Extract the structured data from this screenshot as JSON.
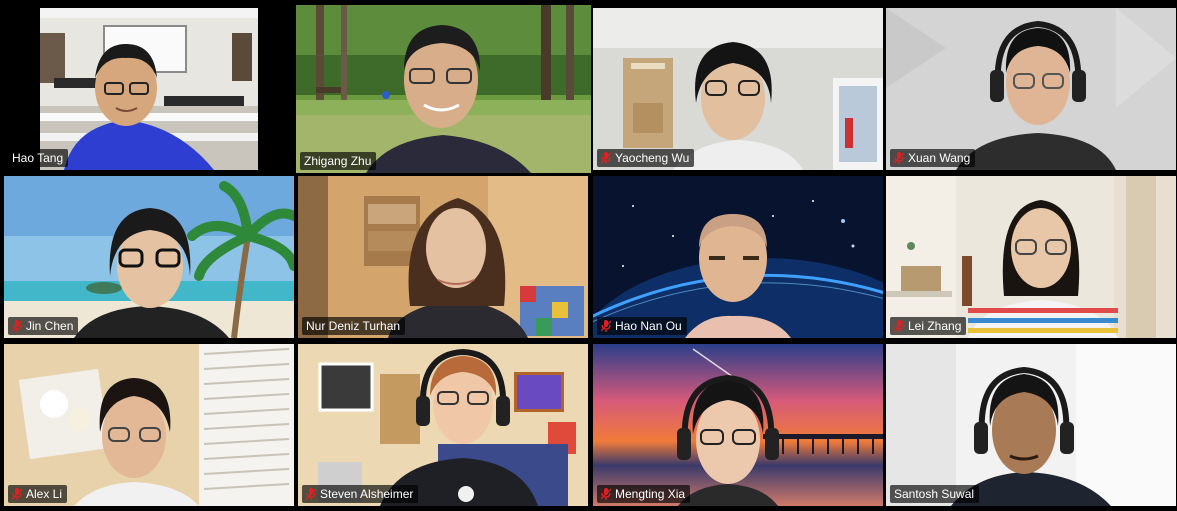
{
  "participants": [
    {
      "name": "Hao Tang",
      "muted": false,
      "active": false,
      "bg": "classroom"
    },
    {
      "name": "Zhigang Zhu",
      "muted": false,
      "active": true,
      "bg": "park"
    },
    {
      "name": "Yaocheng Wu",
      "muted": true,
      "active": false,
      "bg": "room-white"
    },
    {
      "name": "Xuan Wang",
      "muted": true,
      "active": false,
      "bg": "wall-gray"
    },
    {
      "name": "Jin Chen",
      "muted": true,
      "active": false,
      "bg": "beach"
    },
    {
      "name": "Nur Deniz Turhan",
      "muted": false,
      "active": false,
      "bg": "room-warm"
    },
    {
      "name": "Hao Nan Ou",
      "muted": true,
      "active": false,
      "bg": "space"
    },
    {
      "name": "Lei Zhang",
      "muted": true,
      "active": false,
      "bg": "room-shelf"
    },
    {
      "name": "Alex Li",
      "muted": true,
      "active": false,
      "bg": "room-beige"
    },
    {
      "name": "Steven Alsheimer",
      "muted": true,
      "active": false,
      "bg": "room-posters"
    },
    {
      "name": "Mengting Xia",
      "muted": true,
      "active": false,
      "bg": "sunset"
    },
    {
      "name": "Santosh Suwal",
      "muted": false,
      "active": false,
      "bg": "room-plain"
    }
  ],
  "colors": {
    "active_outline": "#b8e986",
    "muted_mic": "#e02020",
    "name_text": "#ffffff"
  }
}
